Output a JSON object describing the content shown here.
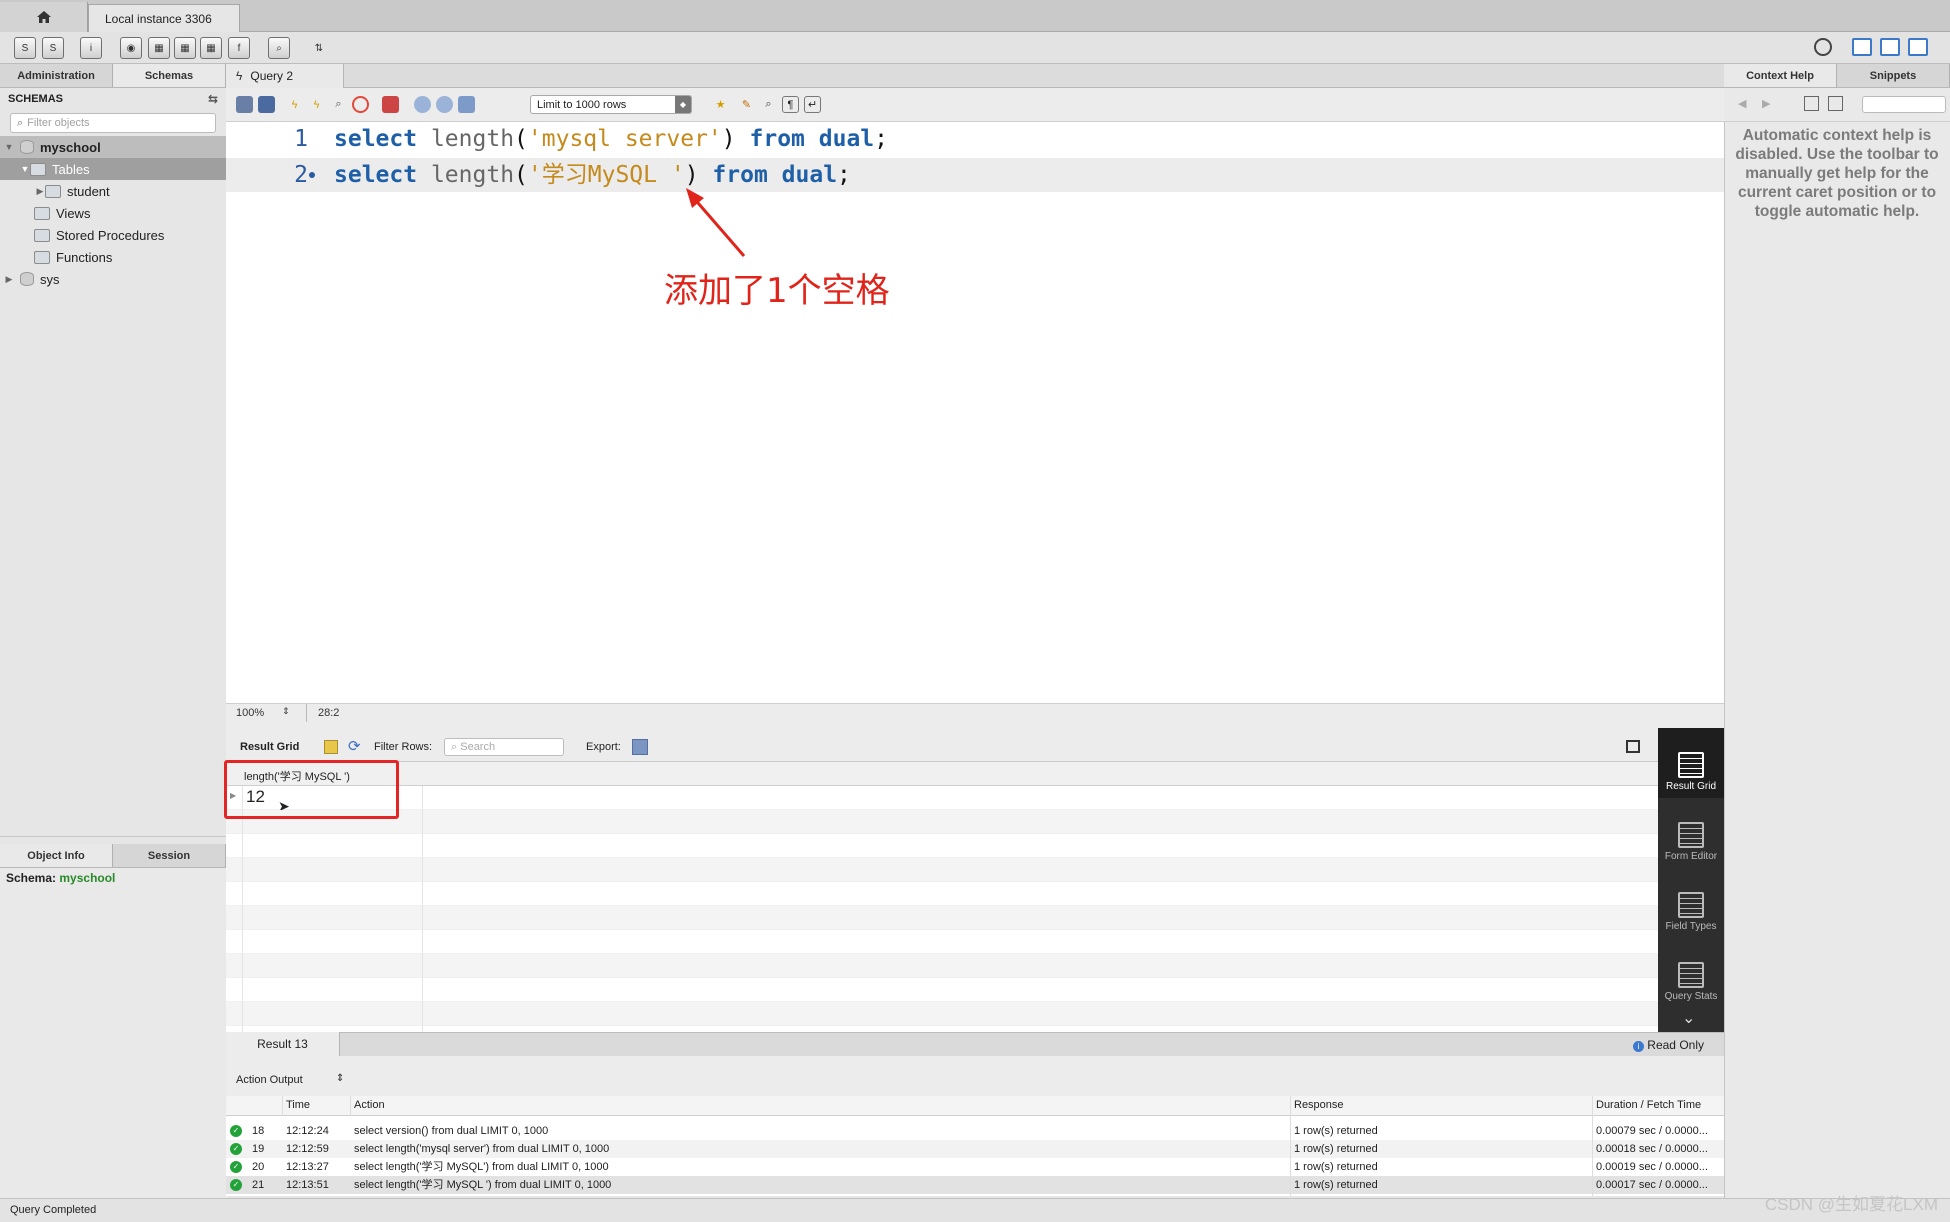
{
  "tabs": {
    "connection": "Local instance 3306"
  },
  "left_panel": {
    "tabs": [
      "Administration",
      "Schemas"
    ],
    "schemas_title": "SCHEMAS",
    "filter_placeholder": "Filter objects",
    "tree": {
      "schema": "myschool",
      "tables": "Tables",
      "table_student": "student",
      "views": "Views",
      "stored_procedures": "Stored Procedures",
      "functions": "Functions",
      "sys": "sys"
    },
    "info_tabs": [
      "Object Info",
      "Session"
    ],
    "schema_label": "Schema:",
    "schema_value": "myschool"
  },
  "query": {
    "tab_label": "Query 2",
    "limit_label": "Limit to 1000 rows",
    "line_numbers": [
      "1",
      "2"
    ],
    "line1": {
      "kw1": "select",
      "fn": "length",
      "open": "(",
      "str": "'mysql server'",
      "close": ")",
      "kw2": "from",
      "kw3": "dual",
      "semi": ";"
    },
    "line2": {
      "kw1": "select",
      "fn": "length",
      "open": "(",
      "str": "'学习MySQL '",
      "close": ")",
      "kw2": "from",
      "kw3": "dual",
      "semi": ";"
    },
    "annotation": "添加了1个空格",
    "zoom": "100%",
    "caret": "28:2"
  },
  "result": {
    "grid_label": "Result Grid",
    "filter_label": "Filter Rows:",
    "search_placeholder": "Search",
    "export_label": "Export:",
    "column_header": "length('学习 MySQL ')",
    "cell_value": "12",
    "side_views": [
      "Result Grid",
      "Form Editor",
      "Field Types",
      "Query Stats"
    ],
    "tab": "Result 13",
    "read_only": "Read Only"
  },
  "output": {
    "title": "Action Output",
    "headers": {
      "time": "Time",
      "action": "Action",
      "response": "Response",
      "duration": "Duration / Fetch Time"
    },
    "rows": [
      {
        "n": "18",
        "time": "12:12:24",
        "action": "select version() from dual LIMIT 0, 1000",
        "response": "1 row(s) returned",
        "duration": "0.00079 sec / 0.0000..."
      },
      {
        "n": "19",
        "time": "12:12:59",
        "action": "select length('mysql server') from dual LIMIT 0, 1000",
        "response": "1 row(s) returned",
        "duration": "0.00018 sec / 0.0000..."
      },
      {
        "n": "20",
        "time": "12:13:27",
        "action": "select length('学习 MySQL') from dual LIMIT 0, 1000",
        "response": "1 row(s) returned",
        "duration": "0.00019 sec / 0.0000..."
      },
      {
        "n": "21",
        "time": "12:13:51",
        "action": "select length('学习 MySQL ') from dual LIMIT 0, 1000",
        "response": "1 row(s) returned",
        "duration": "0.00017 sec / 0.0000..."
      }
    ]
  },
  "right_panel": {
    "tabs": [
      "Context Help",
      "Snippets"
    ],
    "help_text": "Automatic context help is disabled. Use the toolbar to manually get help for the current caret position or to toggle automatic help."
  },
  "status": "Query Completed",
  "watermark": "CSDN @生如夏花LXM"
}
